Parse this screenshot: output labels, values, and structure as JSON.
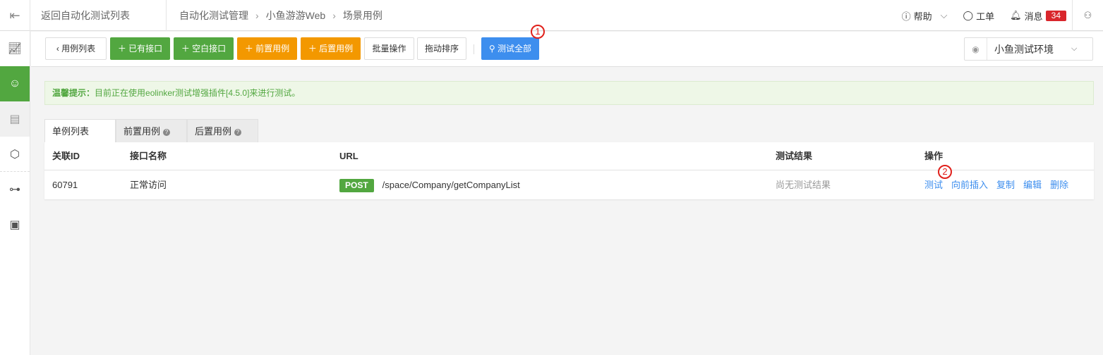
{
  "header": {
    "back_label": "返回自动化测试列表",
    "breadcrumb": [
      "自动化测试管理",
      "小鱼游游Web",
      "场景用例"
    ],
    "help": "帮助",
    "ticket": "工单",
    "messages": "消息",
    "message_count": "34"
  },
  "toolbar": {
    "case_list": "用例列表",
    "existing_api": "已有接口",
    "blank_api": "空白接口",
    "pre_case": "前置用例",
    "post_case": "后置用例",
    "batch": "批量操作",
    "drag_sort": "拖动排序",
    "test_all": "测试全部",
    "env": "小鱼测试环境"
  },
  "annotations": {
    "one": "1",
    "two": "2"
  },
  "alert": {
    "label": "温馨提示：",
    "text": "目前正在使用eolinker测试增强插件[4.5.0]来进行测试。"
  },
  "tabs": [
    "单例列表",
    "前置用例",
    "后置用例"
  ],
  "table": {
    "columns": [
      "关联ID",
      "接口名称",
      "URL",
      "测试结果",
      "操作"
    ],
    "rows": [
      {
        "id": "60791",
        "name": "正常访问",
        "method": "POST",
        "url": "/space/Company/getCompanyList",
        "result": "尚无测试结果",
        "actions": [
          "测试",
          "向前插入",
          "复制",
          "编辑",
          "删除"
        ]
      }
    ]
  },
  "colors": {
    "green": "#52a740",
    "orange": "#f39800",
    "blue": "#3d8eee",
    "badge": "#d9262c"
  }
}
